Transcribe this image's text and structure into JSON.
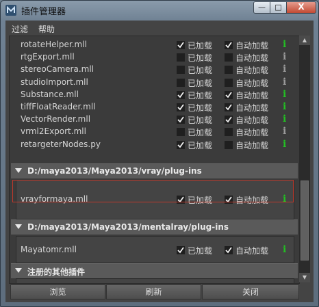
{
  "window": {
    "title": "插件管理器",
    "close_label": "X",
    "minimize_label": "—",
    "maximize_label": "□"
  },
  "menu": [
    "过滤",
    "帮助"
  ],
  "labels": {
    "loaded": "已加载",
    "autoload": "自动加载",
    "info": "i"
  },
  "plugins_top": [
    {
      "name": "rotateHelper.mll",
      "loaded": true,
      "autoload": true,
      "active": true
    },
    {
      "name": "rtgExport.mll",
      "loaded": false,
      "autoload": false,
      "active": false
    },
    {
      "name": "stereoCamera.mll",
      "loaded": false,
      "autoload": false,
      "active": false
    },
    {
      "name": "studioImport.mll",
      "loaded": false,
      "autoload": false,
      "active": false
    },
    {
      "name": "Substance.mll",
      "loaded": true,
      "autoload": true,
      "active": true
    },
    {
      "name": "tiffFloatReader.mll",
      "loaded": true,
      "autoload": true,
      "active": true
    },
    {
      "name": "VectorRender.mll",
      "loaded": true,
      "autoload": true,
      "active": true
    },
    {
      "name": "vrml2Export.mll",
      "loaded": false,
      "autoload": false,
      "active": false
    },
    {
      "name": "retargeterNodes.py",
      "loaded": true,
      "autoload": false,
      "active": true
    }
  ],
  "section_vray": {
    "title": "D:/maya2013/Maya2013/vray/plug-ins",
    "plugins": [
      {
        "name": "vrayformaya.mll",
        "loaded": true,
        "autoload": true,
        "active": true
      }
    ]
  },
  "section_mental": {
    "title": "D:/maya2013/Maya2013/mentalray/plug-ins",
    "plugins": [
      {
        "name": "Mayatomr.mll",
        "loaded": true,
        "autoload": true,
        "active": true
      }
    ]
  },
  "section_other": {
    "title": "注册的其他插件"
  },
  "buttons": {
    "browse": "浏览",
    "refresh": "刷新",
    "close": "关闭"
  },
  "colors": {
    "accent_red": "#c0392b",
    "info_active": "#22c022",
    "info_inactive": "#9a9a9a"
  }
}
